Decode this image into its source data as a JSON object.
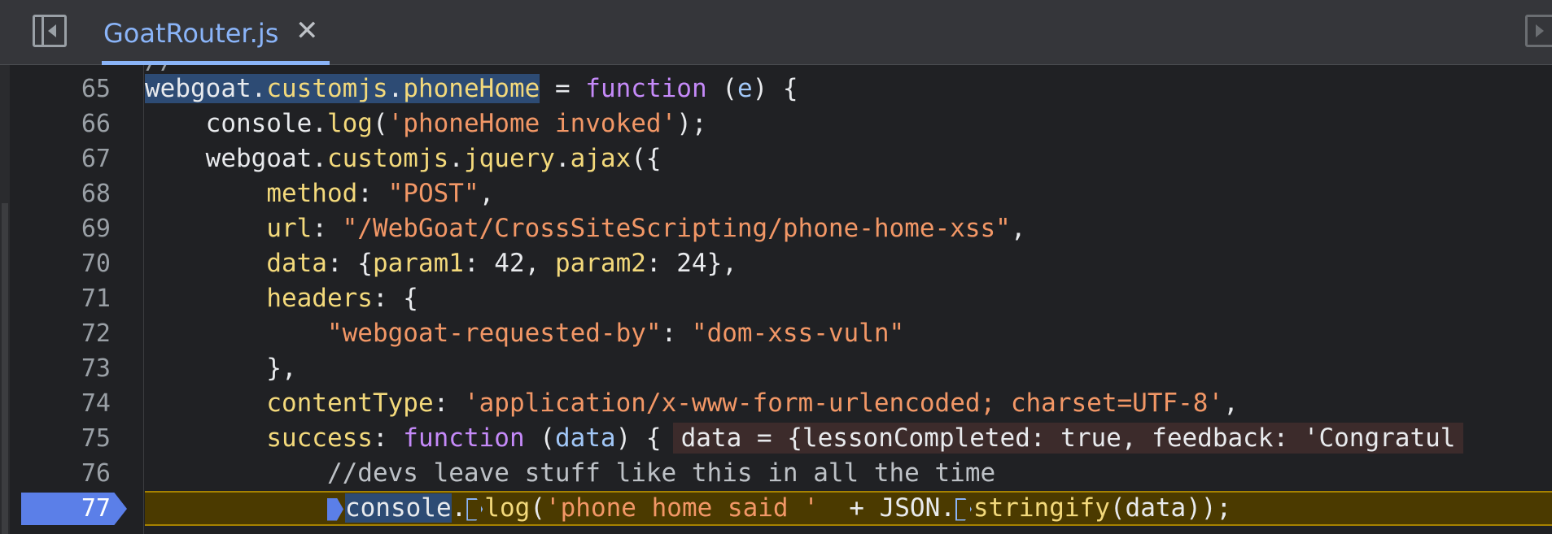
{
  "tab": {
    "file_name": "GoatRouter.js",
    "close_glyph": "✕"
  },
  "gutter": {
    "line_numbers": [
      "65",
      "66",
      "67",
      "68",
      "69",
      "70",
      "71",
      "72",
      "73",
      "74",
      "75",
      "76",
      "77"
    ],
    "active_line": "77"
  },
  "code": {
    "l65": {
      "a": "webgoat",
      "b": ".",
      "c": "customjs",
      "d": ".",
      "e": "phoneHome",
      "f": " = ",
      "g": "function",
      "h": " (",
      "i": "e",
      "j": ") {"
    },
    "l66": {
      "a": "    console.",
      "b": "log",
      "c": "(",
      "d": "'phoneHome invoked'",
      "e": ");"
    },
    "l67": {
      "a": "    webgoat.",
      "b": "customjs",
      "c": ".",
      "d": "jquery",
      "e": ".",
      "f": "ajax",
      "g": "({"
    },
    "l68": {
      "a": "        ",
      "b": "method",
      "c": ": ",
      "d": "\"POST\"",
      "e": ","
    },
    "l69": {
      "a": "        ",
      "b": "url",
      "c": ": ",
      "d": "\"/WebGoat/CrossSiteScripting/phone-home-xss\"",
      "e": ","
    },
    "l70": {
      "a": "        ",
      "b": "data",
      "c": ": {",
      "d": "param1",
      "e": ": 42, ",
      "f": "param2",
      "g": ": 24},"
    },
    "l71": {
      "a": "        ",
      "b": "headers",
      "c": ": {"
    },
    "l72": {
      "a": "            ",
      "b": "\"webgoat-requested-by\"",
      "c": ": ",
      "d": "\"dom-xss-vuln\""
    },
    "l73": {
      "a": "        },"
    },
    "l74": {
      "a": "        ",
      "b": "contentType",
      "c": ": ",
      "d": "'application/x-www-form-urlencoded; charset=UTF-8'",
      "e": ","
    },
    "l75": {
      "a": "        ",
      "b": "success",
      "c": ": ",
      "d": "function",
      "e": " (",
      "f": "data",
      "g": ") {",
      "inline": "data = {lessonCompleted: true, feedback: 'Congratul"
    },
    "l76": {
      "a": "            //devs leave stuff like this in all the time"
    },
    "l77": {
      "a": "            ",
      "b": "console",
      "c": ".",
      "d": "log",
      "e": "(",
      "f": "'phone home said '",
      "g": "  + JSON.",
      "h": "stringify",
      "i": "(data));"
    }
  },
  "colors": {
    "keyword": "#c58af9",
    "property": "#f3d97b",
    "string": "#f29766",
    "breakpoint": "#5b7fe8",
    "execution_line": "#4b3a00"
  }
}
